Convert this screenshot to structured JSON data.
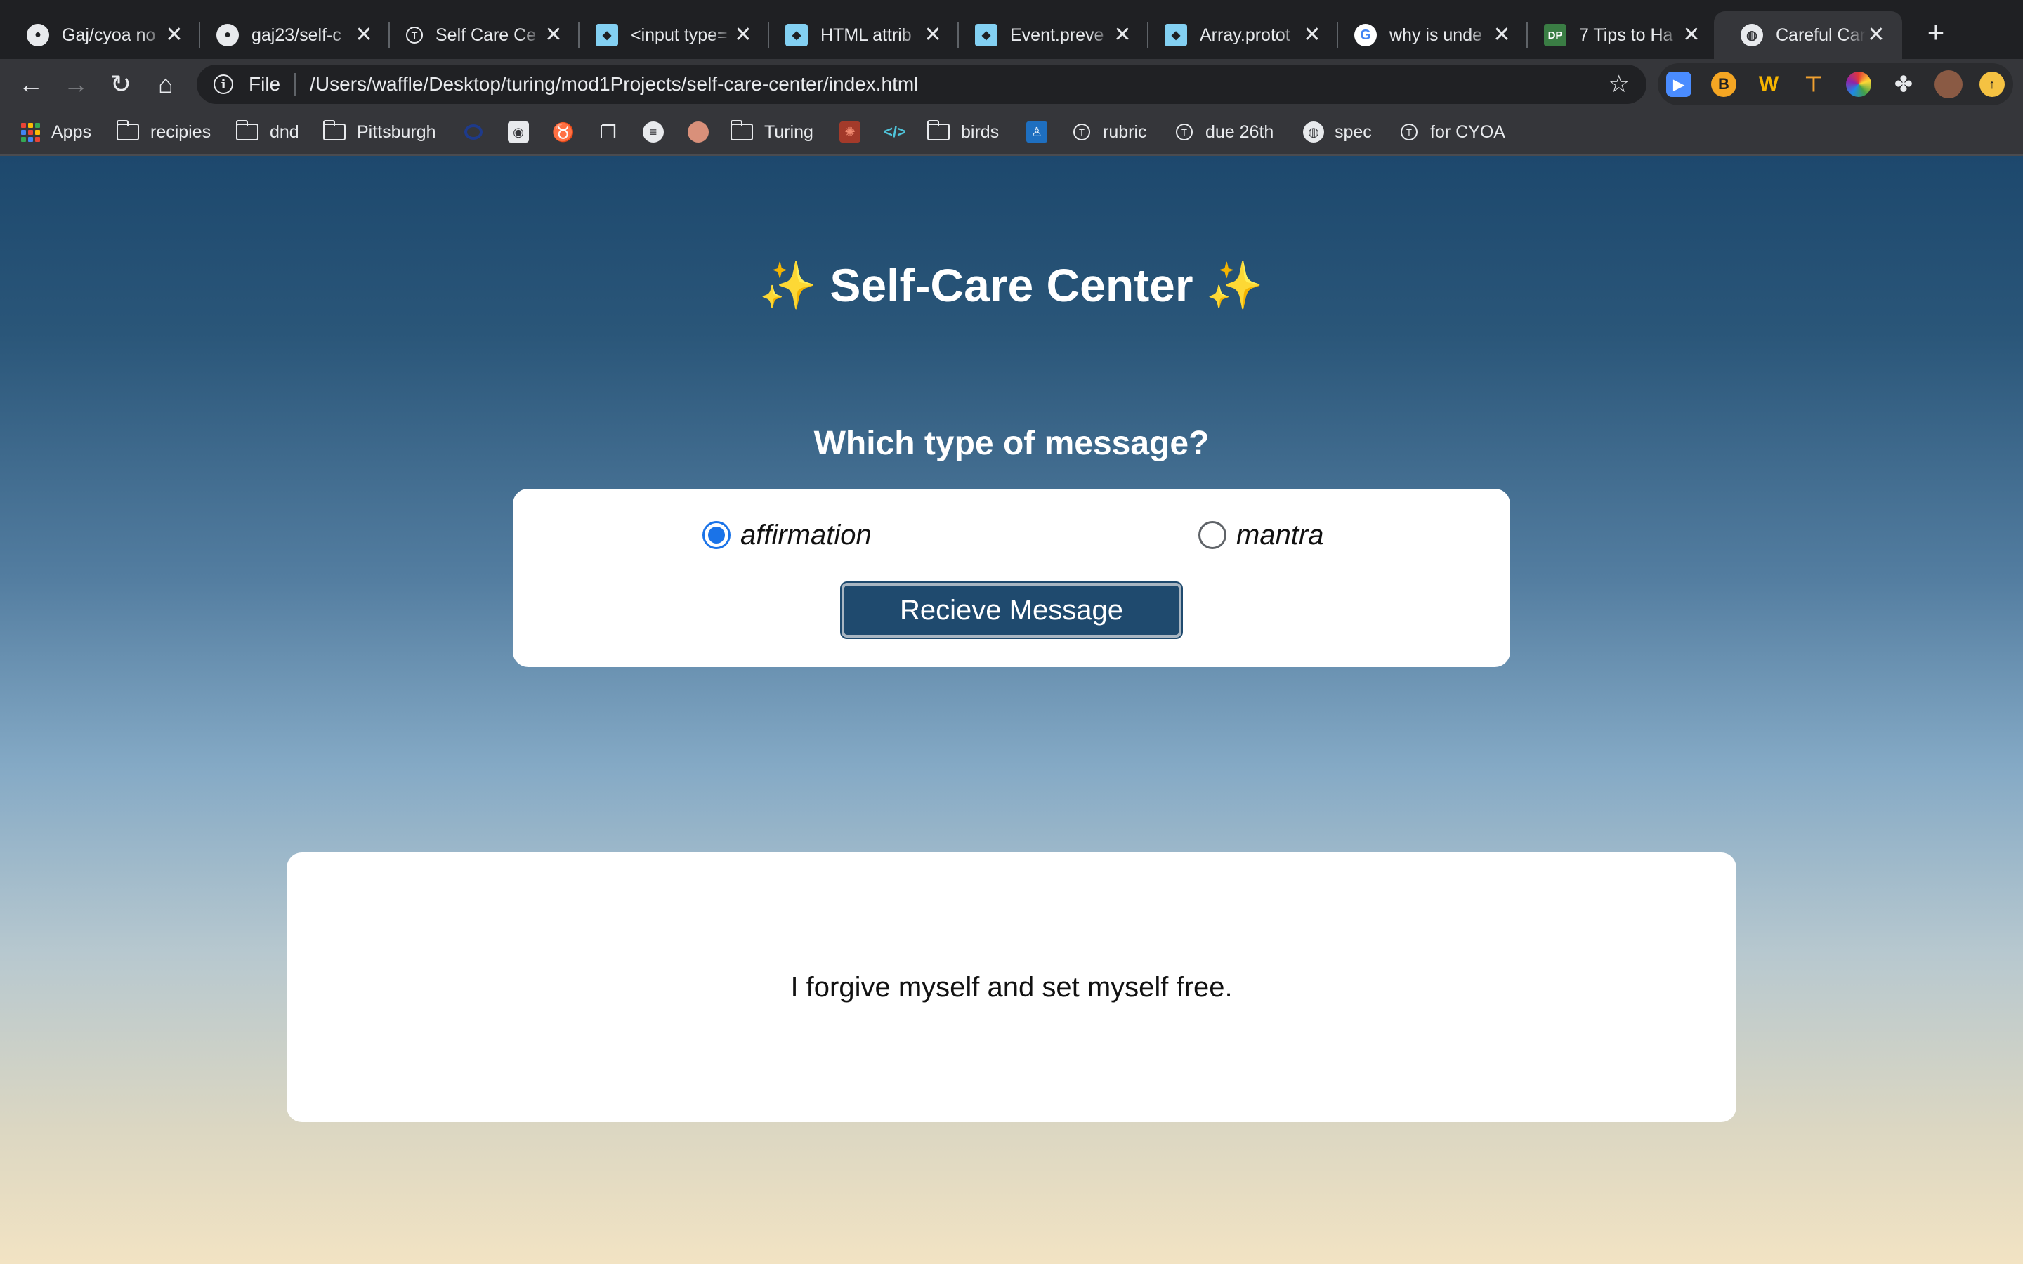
{
  "tabs": [
    {
      "title": "Gaj/cyoa no",
      "icon": "github-icon",
      "active": false
    },
    {
      "title": "gaj23/self-c",
      "icon": "github-icon",
      "active": false
    },
    {
      "title": "Self Care Ce",
      "icon": "turing-icon",
      "active": false
    },
    {
      "title": "<input type=",
      "icon": "mdn-icon",
      "active": false
    },
    {
      "title": "HTML attrib",
      "icon": "mdn-icon",
      "active": false
    },
    {
      "title": "Event.preve",
      "icon": "mdn-icon",
      "active": false
    },
    {
      "title": "Array.protot",
      "icon": "mdn-icon",
      "active": false
    },
    {
      "title": "why is unde",
      "icon": "google-icon",
      "active": false
    },
    {
      "title": "7 Tips to Ha",
      "icon": "dp-icon",
      "icon_text": "DP",
      "active": false
    },
    {
      "title": "Careful Care",
      "icon": "globe-icon",
      "active": true
    }
  ],
  "toolbar": {
    "scheme_label": "File",
    "url": "/Users/waffle/Desktop/turing/mod1Projects/self-care-center/index.html"
  },
  "bookmarks": [
    {
      "label": "Apps",
      "icon": "apps-grid-icon"
    },
    {
      "label": "recipies",
      "icon": "folder-icon"
    },
    {
      "label": "dnd",
      "icon": "folder-icon"
    },
    {
      "label": "Pittsburgh",
      "icon": "folder-icon"
    },
    {
      "label": "",
      "icon": "ring-icon"
    },
    {
      "label": "",
      "icon": "shield-badge-icon"
    },
    {
      "label": "",
      "icon": "viking-icon"
    },
    {
      "label": "",
      "icon": "docs-icon"
    },
    {
      "label": "",
      "icon": "list-circle-icon"
    },
    {
      "label": "",
      "icon": "peach-circle-icon"
    },
    {
      "label": "Turing",
      "icon": "folder-icon"
    },
    {
      "label": "",
      "icon": "red-square-icon"
    },
    {
      "label": "",
      "icon": "code-icon"
    },
    {
      "label": "birds",
      "icon": "folder-icon"
    },
    {
      "label": "",
      "icon": "blue-person-icon"
    },
    {
      "label": "rubric",
      "icon": "turing-icon"
    },
    {
      "label": "due 26th",
      "icon": "turing-icon"
    },
    {
      "label": "spec",
      "icon": "globe-icon"
    },
    {
      "label": "for CYOA",
      "icon": "turing-icon"
    }
  ],
  "page": {
    "title": "✨ Self-Care Center ✨",
    "question": "Which type of message?",
    "options": [
      {
        "label": "affirmation",
        "checked": true
      },
      {
        "label": "mantra",
        "checked": false
      }
    ],
    "button_label": "Recieve Message",
    "message": "I forgive myself and set myself free."
  },
  "colors": {
    "gradient_top": "#1d486d",
    "gradient_bottom": "#f2e3c3",
    "button_bg": "#1f4a6e",
    "radio_accent": "#1a73e8"
  }
}
